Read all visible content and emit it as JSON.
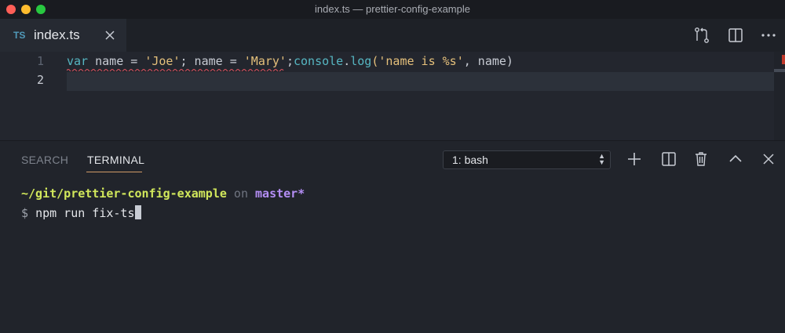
{
  "window": {
    "title": "index.ts — prettier-config-example"
  },
  "tab": {
    "lang_badge": "TS",
    "title": "index.ts"
  },
  "editor": {
    "line_numbers": [
      "1",
      "2"
    ],
    "line1": {
      "t1": "var",
      "t2": " name = ",
      "t3": "'Joe'",
      "t4": "; name = ",
      "t5": "'Mary'",
      "t6": ";",
      "t7": "console",
      "t8": ".",
      "t9": "log",
      "t10": "(",
      "t11": "'name is %s'",
      "t12": ", name)"
    }
  },
  "panel": {
    "tabs": [
      "SEARCH",
      "TERMINAL"
    ],
    "terminal_select": "1: bash"
  },
  "terminal": {
    "cwd": "~/git/prettier-config-example",
    "on": " on ",
    "branch": "master*",
    "prompt": "$ ",
    "command": "npm run fix-ts"
  },
  "colors": {
    "accent_underline": "#d19a66",
    "cwd": "#d1e75b",
    "branch": "#b48ef5",
    "ts_badge": "#519aba",
    "squiggle": "#e05561"
  },
  "icons": [
    "source-control-icon",
    "split-editor-icon",
    "more-actions-icon",
    "add-terminal-icon",
    "split-terminal-icon",
    "trash-icon",
    "chevron-up-icon",
    "close-panel-icon"
  ]
}
